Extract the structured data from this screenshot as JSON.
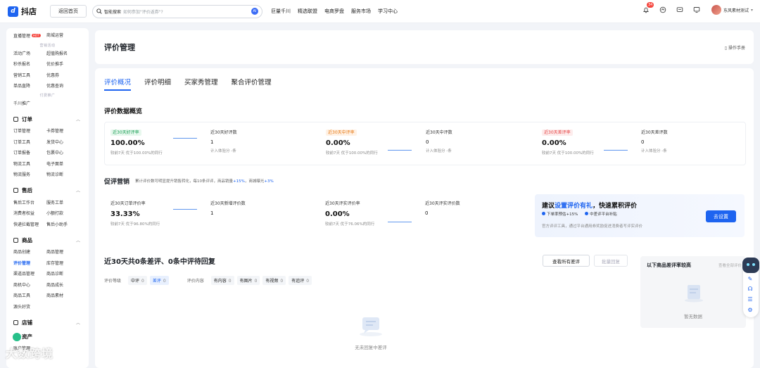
{
  "app": {
    "name": "抖店",
    "back_label": "返回首页"
  },
  "search": {
    "label": "智能搜索",
    "placeholder": "如何参加\"评价返券\"?",
    "ai_label": "AI"
  },
  "topnav": [
    "巨量千川",
    "精选联盟",
    "电商罗盘",
    "服务市场",
    "学习中心"
  ],
  "topright": {
    "notification_count": "34",
    "username": "东风素材测试"
  },
  "sidebar": {
    "top_rows": [
      [
        "直播管理",
        "商城运营"
      ]
    ],
    "top_hot_badge": "HOT",
    "divider_marketing": "营销活动",
    "marketing_rows": [
      [
        "活动广场",
        "超值购报名"
      ],
      [
        "秒杀报名",
        "优价推手"
      ],
      [
        "营销工具",
        "优惠券"
      ],
      [
        "单品直降",
        "优惠查询"
      ]
    ],
    "divider_ads": "付费推广",
    "ads_rows": [
      [
        "千川推广",
        ""
      ]
    ],
    "sections": [
      {
        "title": "订单",
        "rows": [
          [
            "订单管理",
            "卡券管理"
          ],
          [
            "订单工具",
            "发货中心"
          ],
          [
            "订单报备",
            "包裹中心"
          ],
          [
            "物流工具",
            "电子面单"
          ],
          [
            "物流服务",
            "物流诊断"
          ]
        ]
      },
      {
        "title": "售后",
        "rows": [
          [
            "售后工作台",
            "服务工单"
          ],
          [
            "消费者权益",
            "小额打款"
          ],
          [
            "快递拦截管理",
            "售后小助手"
          ]
        ]
      },
      {
        "title": "商品",
        "rows": [
          [
            "商品创建",
            "商品管理"
          ],
          [
            "评价管理",
            "库存管理"
          ],
          [
            "渠道品管理",
            "商品诊断"
          ],
          [
            "商机中心",
            "商品成长"
          ],
          [
            "商品工具",
            "商品素材"
          ],
          [
            "源头好货",
            ""
          ]
        ]
      },
      {
        "title": "店铺",
        "rows": []
      }
    ],
    "partial_bottom": [
      "资产",
      "账户管理"
    ]
  },
  "page": {
    "title": "评价管理",
    "manual": "操作手册"
  },
  "tabs": [
    "评价概况",
    "评价明细",
    "买家秀管理",
    "聚合评价管理"
  ],
  "overview": {
    "title": "评价数据概览",
    "stats": [
      {
        "label": "近30天好评率",
        "value": "100.00%",
        "sub": "较前7天    优于100.00%的同行",
        "tone": "green"
      },
      {
        "label": "近30天好评数",
        "value": "1",
        "sub": "计入体验分 -条",
        "tone": "plain"
      },
      {
        "label": "近30天中评率",
        "value": "0.00%",
        "sub": "较前7天    优于100.00%的同行",
        "tone": "orange"
      },
      {
        "label": "近30天中评数",
        "value": "0",
        "sub": "计入体验分 -条",
        "tone": "plain"
      },
      {
        "label": "近30天差评率",
        "value": "0.00%",
        "sub": "较前7天    优于100.00%的同行",
        "tone": "red"
      },
      {
        "label": "近30天差评数",
        "value": "0",
        "sub": "计入体验分 -条",
        "tone": "plain"
      }
    ]
  },
  "promotion": {
    "title": "促评营销",
    "desc_prefix": "累计评价数可明显提升销售转化，每10条评评，商品销量",
    "desc_hl1": "+15%",
    "desc_mid": "，商城曝光",
    "desc_hl2": "+3%",
    "stats": [
      {
        "label": "近30天订单评价率",
        "value": "33.33%",
        "sub": "较前7天    优于96.80%的同行"
      },
      {
        "label": "近30天新增评价数",
        "value": "1",
        "sub": ""
      },
      {
        "label": "近30天评实评价率",
        "value": "0.00%",
        "sub": "较前7天    优于76.06%的同行"
      },
      {
        "label": "近30天评实评价数",
        "value": "0",
        "sub": ""
      }
    ],
    "card": {
      "title_prefix": "建议",
      "title_hl": "设置评价有礼",
      "title_suffix": "，快速累积评价",
      "check1": "下单率预估+15%",
      "check2": "中差评平台补贴",
      "desc": "官方评评工具，通过平台通用券奖励促进消费者写评实评价",
      "button": "去设置"
    }
  },
  "reply": {
    "title": "近30天共0条差评、0条中评待回复",
    "view_all": "查看所有差评",
    "batch_reply": "批量回复",
    "level_label": "评价等级",
    "levels": [
      {
        "label": "中评",
        "count": "0"
      },
      {
        "label": "差评",
        "count": "0"
      }
    ],
    "content_label": "评价内容",
    "contents": [
      {
        "label": "有内容",
        "count": "0"
      },
      {
        "label": "有图片",
        "count": "0"
      },
      {
        "label": "有视频",
        "count": "0"
      },
      {
        "label": "有追评",
        "count": "0"
      }
    ],
    "empty_text": "无未回复中差评"
  },
  "right_panel": {
    "title": "以下商品差评率较高",
    "link": "查看全部评价",
    "empty_text": "暂无数据"
  },
  "watermark": "大数跨境"
}
